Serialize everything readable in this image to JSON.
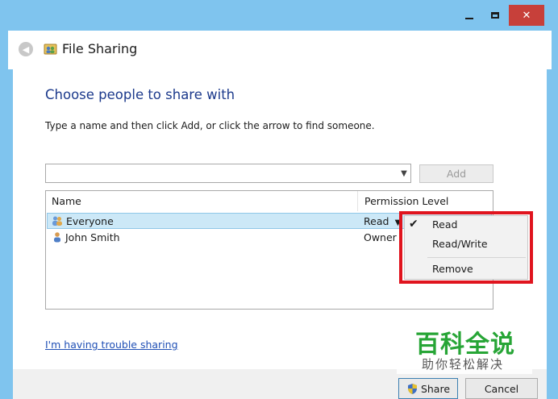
{
  "window": {
    "title": "File Sharing",
    "controls": {
      "minimize": "minimize",
      "maximize": "maximize",
      "close": "✕"
    }
  },
  "main": {
    "heading": "Choose people to share with",
    "instruction": "Type a name and then click Add, or click the arrow to find someone.",
    "name_input": {
      "value": "",
      "placeholder": ""
    },
    "add_label": "Add",
    "columns": {
      "name": "Name",
      "permission": "Permission Level"
    },
    "rows": [
      {
        "name": "Everyone",
        "permission": "Read",
        "icon": "users-icon",
        "selected": true
      },
      {
        "name": "John Smith",
        "permission": "Owner",
        "icon": "user-icon",
        "selected": false
      }
    ],
    "permission_menu": {
      "items": [
        "Read",
        "Read/Write",
        "Remove"
      ],
      "checked": "Read"
    },
    "trouble_link": "I'm having trouble sharing"
  },
  "footer": {
    "share_label": "Share",
    "cancel_label": "Cancel"
  },
  "watermark": {
    "main": "百科全说",
    "sub": "助你轻松解决"
  },
  "colors": {
    "frame": "#7fc4ee",
    "heading": "#1c3a8c",
    "link": "#1f4fb5",
    "highlight": "#e0141e",
    "selection": "#cce8f7"
  }
}
